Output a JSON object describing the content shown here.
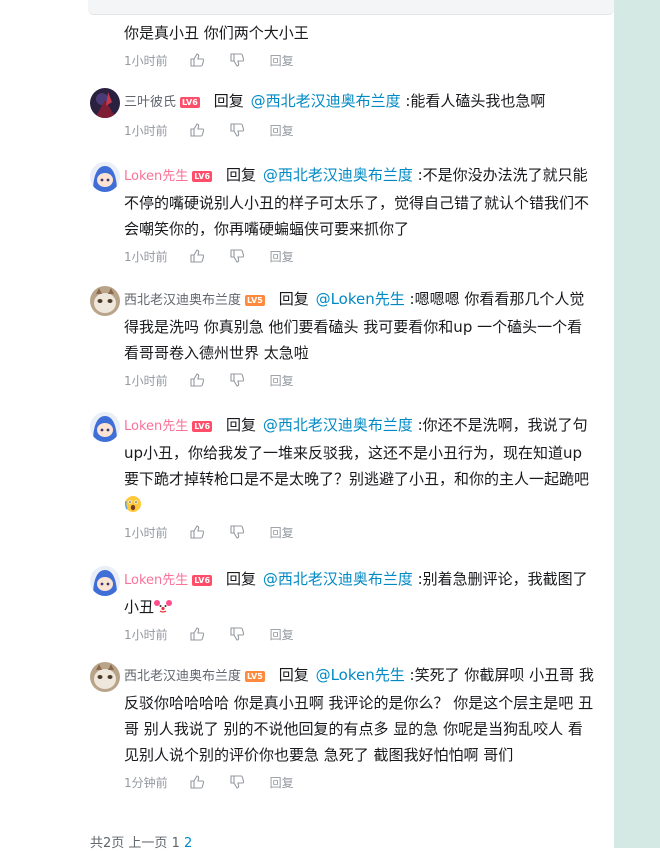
{
  "colors": {
    "username_vip": "#fb7299",
    "mention": "#008ac5",
    "meta": "#9499a0",
    "lv6": "#ff4d6a",
    "lv5": "#ff8a3d"
  },
  "reply_label": "回复",
  "action_reply": "回复",
  "top_fragment": {
    "text": "你是真小丑 你们两个大小王",
    "time": "1小时前"
  },
  "replies": [
    {
      "user": "三叶彼氏",
      "level": "LV6",
      "mention": "@西北老汉迪奥布兰度",
      "content": " :能看人磕头我也急啊",
      "time": "1小时前"
    },
    {
      "user": "Loken先生",
      "level": "LV6",
      "mention": "@西北老汉迪奥布兰度",
      "content": " :不是你没办法洗了就只能不停的嘴硬说别人小丑的样子可太乐了，觉得自己错了就认个错我们不会嘲笑你的，你再嘴硬蝙蝠侠可要来抓你了",
      "time": "1小时前"
    },
    {
      "user": "西北老汉迪奥布兰度",
      "level": "LV5",
      "mention": "@Loken先生",
      "content": " :嗯嗯嗯 你看看那几个人觉得我是洗吗 你真别急 他们要看磕头 我可要看你和up 一个磕头一个看看哥哥卷入德州世界 太急啦",
      "time": "1小时前"
    },
    {
      "user": "Loken先生",
      "level": "LV6",
      "mention": "@西北老汉迪奥布兰度",
      "content": " :你还不是洗啊，我说了句up小丑，你给我发了一堆来反驳我，这还不是小丑行为，现在知道up要下跪才掉转枪口是不是太晚了？别逃避了小丑，和你的主人一起跪吧",
      "time": "1小时前"
    },
    {
      "user": "Loken先生",
      "level": "LV6",
      "mention": "@西北老汉迪奥布兰度",
      "content": " :别着急删评论，我截图了小丑",
      "time": "1小时前"
    },
    {
      "user": "西北老汉迪奥布兰度",
      "level": "LV5",
      "mention": "@Loken先生",
      "content": " :笑死了 你截屏呗 小丑哥 我反驳你哈哈哈哈 你是真小丑啊 我评论的是你么？ 你是这个层主是吧 丑哥 别人我说了 别的不说他回复的有点多 显的急 你呢是当狗乱咬人 看见别人说个别的评价你也要急 急死了 截图我好怕怕啊 哥们",
      "time": "1分钟前"
    }
  ],
  "pager": {
    "total": "共2页",
    "prev": "上一页",
    "p1": "1",
    "p2": "2"
  }
}
